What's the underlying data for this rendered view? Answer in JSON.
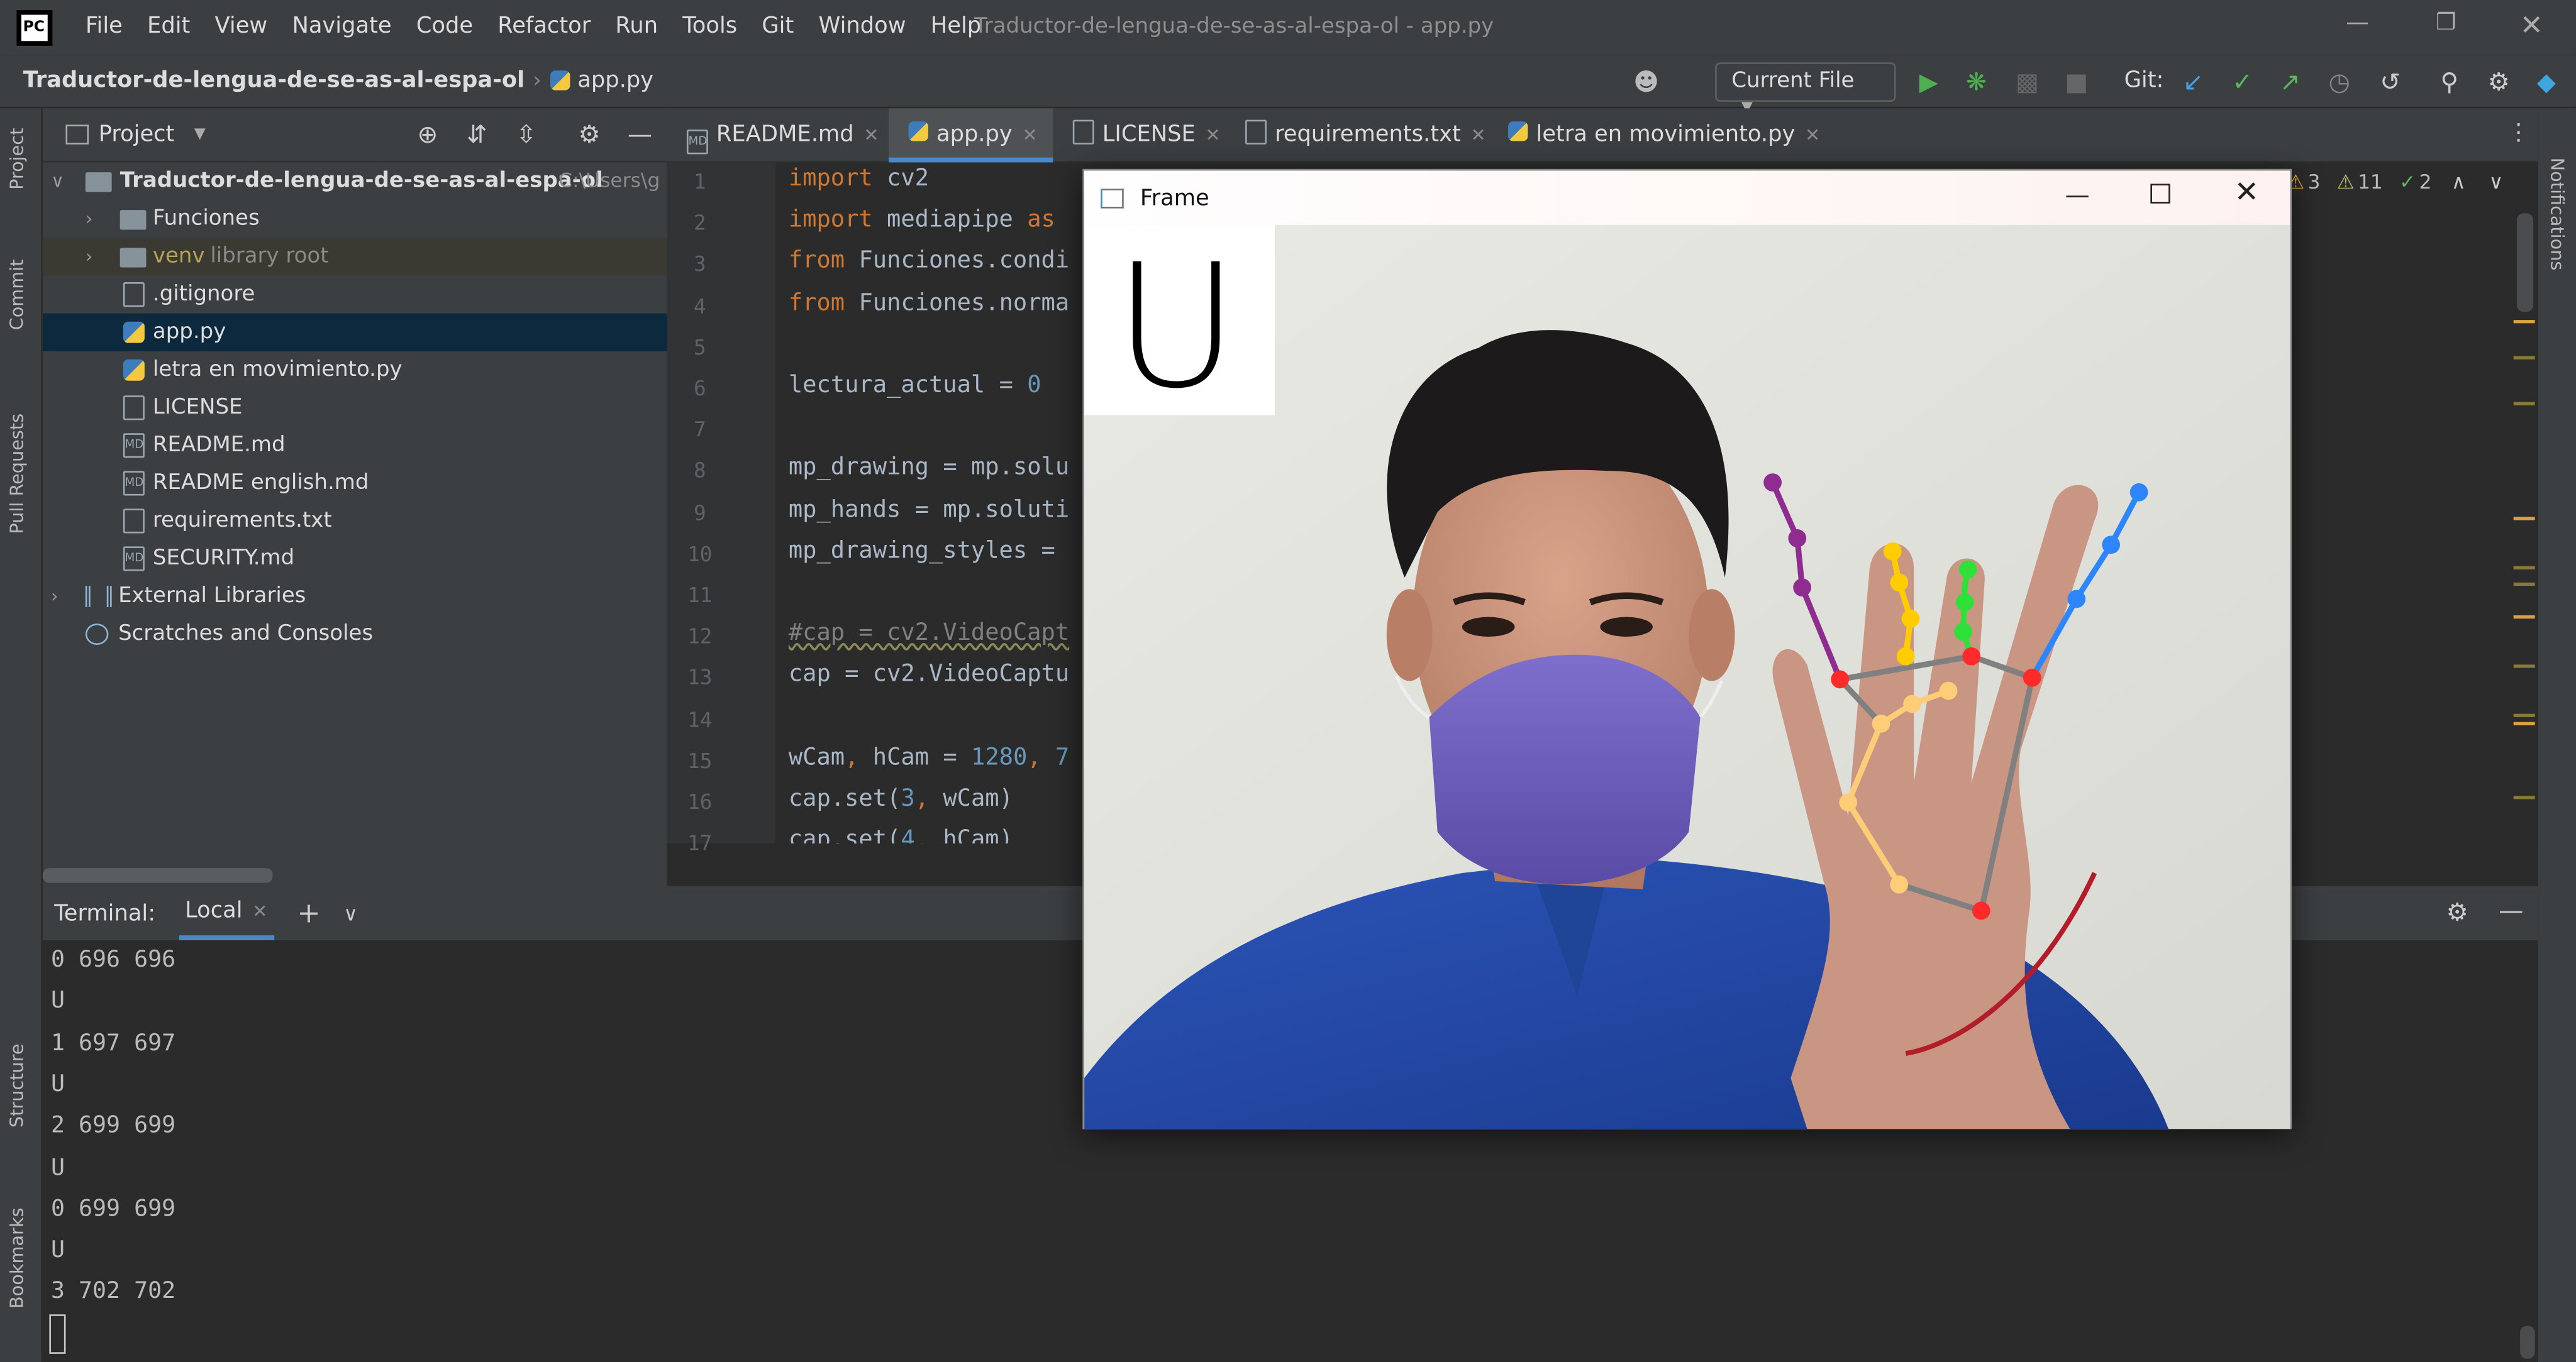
{
  "menubar": {
    "items": [
      "File",
      "Edit",
      "View",
      "Navigate",
      "Code",
      "Refactor",
      "Run",
      "Tools",
      "Git",
      "Window",
      "Help"
    ],
    "window_title": "Traductor-de-lengua-de-se-as-al-espa-ol - app.py"
  },
  "navbar": {
    "project": "Traductor-de-lengua-de-se-as-al-espa-ol",
    "file": "app.py",
    "run_config": "Current File",
    "git_label": "Git:"
  },
  "left_stripe": [
    "Project",
    "Commit",
    "Pull Requests",
    "Structure",
    "Bookmarks"
  ],
  "right_stripe": [
    "Notifications"
  ],
  "project_pane": {
    "title": "Project",
    "tree": [
      {
        "label": "Traductor-de-lengua-de-se-as-al-espa-ol",
        "extra": "C:\\Users\\g",
        "kind": "root"
      },
      {
        "label": "Funciones",
        "kind": "folder"
      },
      {
        "label": "venv",
        "extra": "library root",
        "kind": "venv"
      },
      {
        "label": ".gitignore",
        "kind": "file"
      },
      {
        "label": "app.py",
        "kind": "py"
      },
      {
        "label": "letra en movimiento.py",
        "kind": "py"
      },
      {
        "label": "LICENSE",
        "kind": "file"
      },
      {
        "label": "README.md",
        "kind": "md"
      },
      {
        "label": "README english.md",
        "kind": "md"
      },
      {
        "label": "requirements.txt",
        "kind": "file"
      },
      {
        "label": "SECURITY.md",
        "kind": "md"
      },
      {
        "label": "External Libraries",
        "kind": "lib"
      },
      {
        "label": "Scratches and Consoles",
        "kind": "scratch"
      }
    ]
  },
  "editor": {
    "tabs": [
      "README.md",
      "app.py",
      "LICENSE",
      "requirements.txt",
      "letra en movimiento.py"
    ],
    "active_tab": "app.py",
    "inspections": {
      "warnings": "3",
      "weak_warnings": "11",
      "ok": "2"
    },
    "lines": [
      "import cv2",
      "import mediapipe as",
      "from Funciones.condi",
      "from Funciones.norma",
      "",
      "lectura_actual = 0",
      "",
      "mp_drawing = mp.solu",
      "mp_hands = mp.soluti",
      "mp_drawing_styles = ",
      "",
      "#cap = cv2.VideoCapt",
      "cap = cv2.VideoCaptu",
      "",
      "wCam, hCam = 1280, 7",
      "cap.set(3, wCam)",
      "cap.set(4, hCam)"
    ]
  },
  "terminal": {
    "title": "Terminal:",
    "tab": "Local",
    "lines": [
      "0 696 696",
      "U",
      "1 697 697",
      "U",
      "2 699 699",
      "U",
      "0 699 699",
      "U",
      "3 702 702"
    ]
  },
  "cv_window": {
    "title": "Frame",
    "detected_letter": "U"
  },
  "colors": {
    "ide_bg": "#2b2b2b",
    "panel_bg": "#3c3f41",
    "selection": "#0d293e",
    "accent": "#4a88c7",
    "keyword": "#cc7832",
    "number": "#6897bb",
    "landmark_red": "#ff2a2a",
    "landmark_blue": "#2e86ff",
    "landmark_green": "#2fe03a",
    "landmark_yellow": "#ffcc00",
    "landmark_purple": "#8e2d8f",
    "mask_purple": "#6b5bb8"
  }
}
